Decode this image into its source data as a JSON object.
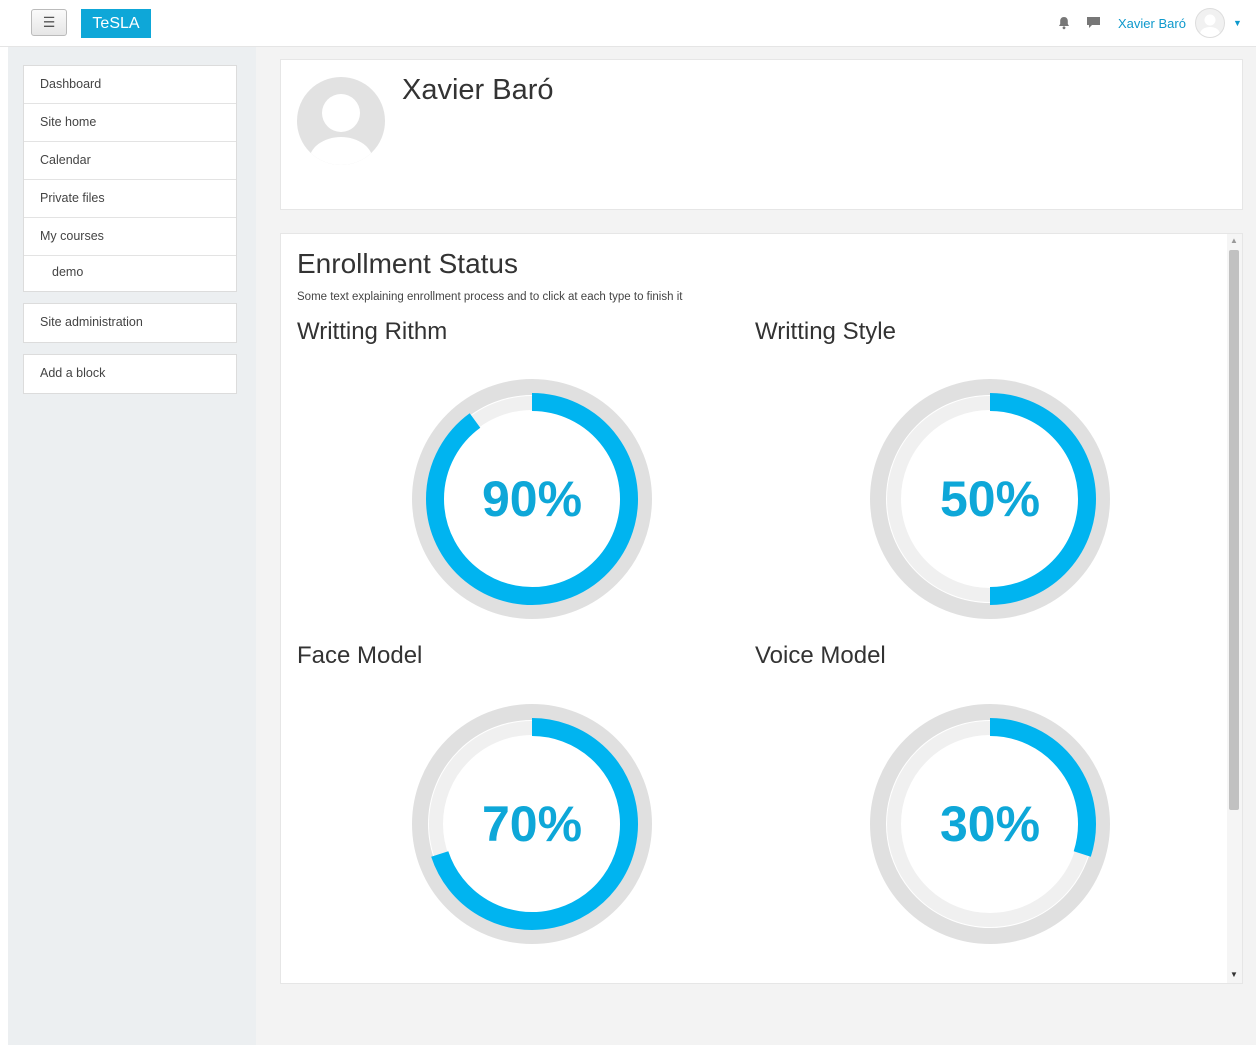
{
  "navbar": {
    "menu_icon": "☰",
    "brand": "TeSLA",
    "user_name": "Xavier Baró",
    "icons": [
      "bell-icon",
      "chat-icon",
      "avatar",
      "caret-down-icon"
    ]
  },
  "sidebar": {
    "items": [
      {
        "label": "Dashboard"
      },
      {
        "label": "Site home"
      },
      {
        "label": "Calendar"
      },
      {
        "label": "Private files"
      },
      {
        "label": "My courses"
      },
      {
        "label": "demo"
      }
    ],
    "admin_label": "Site administration",
    "add_block_label": "Add a block"
  },
  "profile": {
    "name": "Xavier Baró"
  },
  "enrollment": {
    "title": "Enrollment Status",
    "description": "Some text explaining enrollment process and to click at each type to finish it",
    "accent_color": "#00b4f0",
    "models": [
      {
        "title": "Writting Rithm",
        "percent": 90,
        "label": "90%"
      },
      {
        "title": "Writting Style",
        "percent": 50,
        "label": "50%"
      },
      {
        "title": "Face Model",
        "percent": 70,
        "label": "70%"
      },
      {
        "title": "Voice Model",
        "percent": 30,
        "label": "30%"
      }
    ]
  }
}
